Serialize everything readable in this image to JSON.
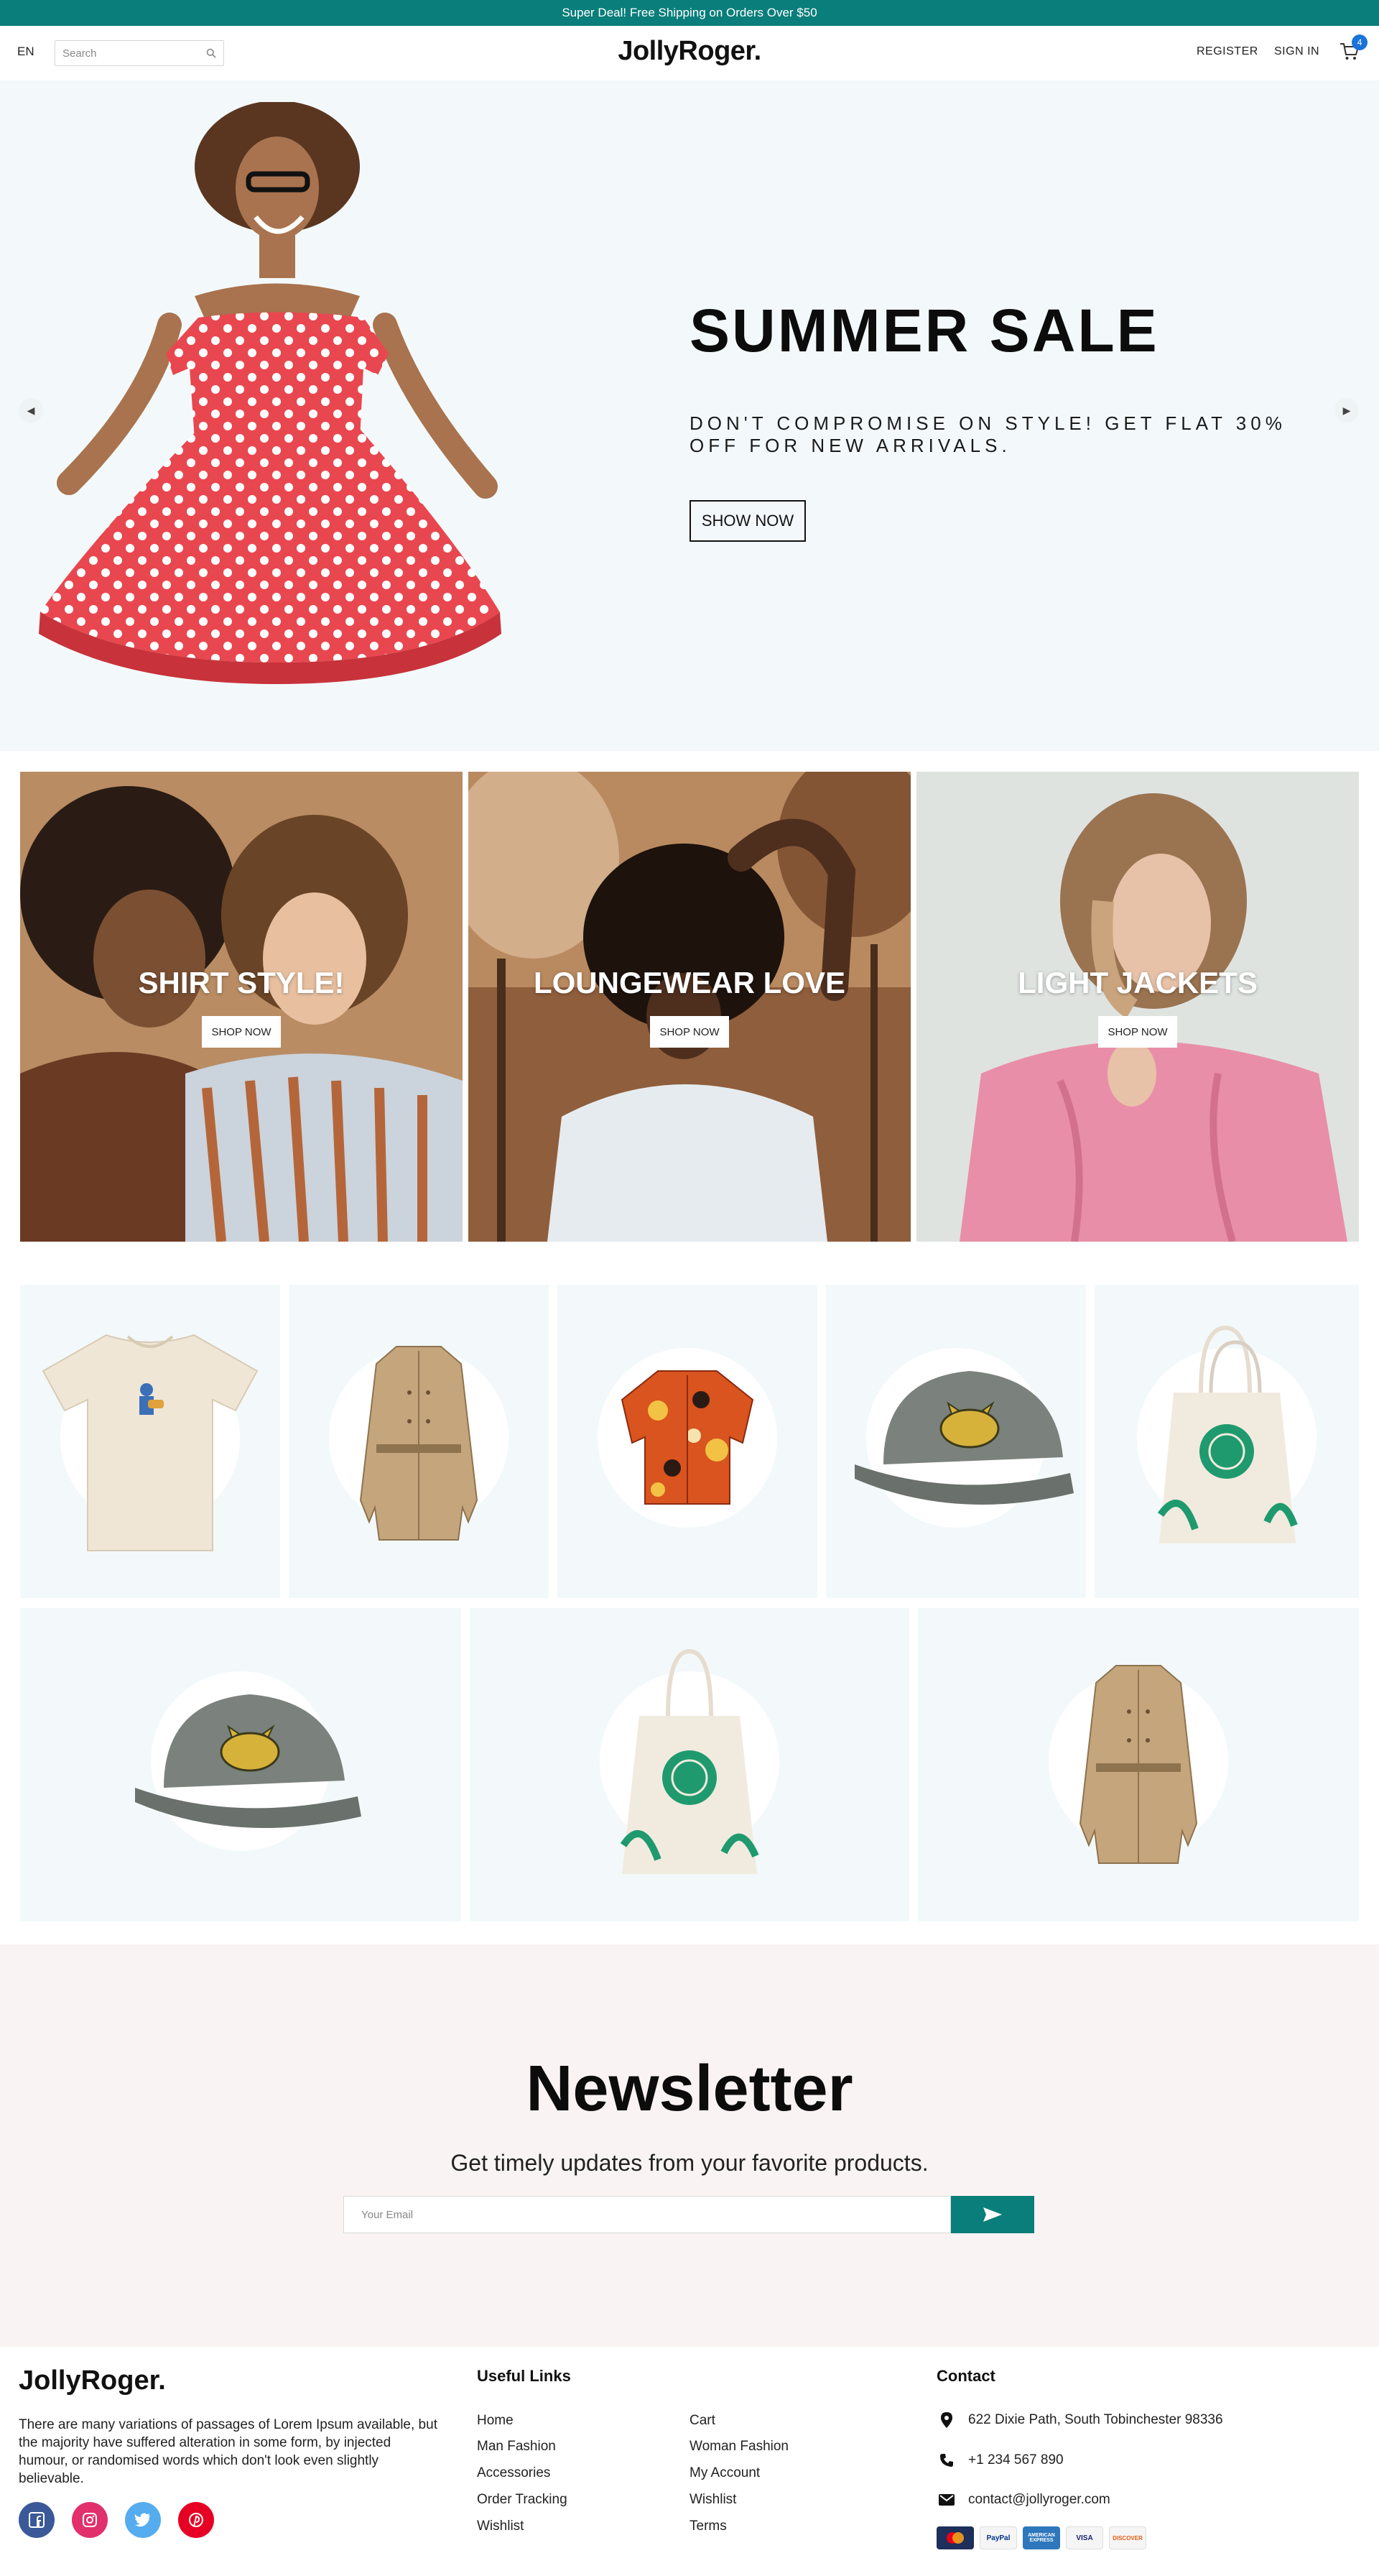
{
  "announcement": "Super Deal! Free Shipping on Orders Over $50",
  "header": {
    "language": "EN",
    "search_placeholder": "Search",
    "logo": "JollyRoger.",
    "register": "REGISTER",
    "sign_in": "SIGN IN",
    "cart_count": "4"
  },
  "hero": {
    "title": "SUMMER SALE",
    "subtitle": "DON'T COMPROMISE ON STYLE! GET FLAT 30% OFF FOR NEW ARRIVALS.",
    "button": "SHOW NOW",
    "prev_icon": "chevron-left-icon",
    "next_icon": "chevron-right-icon"
  },
  "categories": [
    {
      "title": "SHIRT STYLE!",
      "button": "SHOP NOW"
    },
    {
      "title": "LOUNGEWEAR LOVE",
      "button": "SHOP NOW"
    },
    {
      "title": "LIGHT JACKETS",
      "button": "SHOP NOW"
    }
  ],
  "products": [
    {
      "item": "t-shirt"
    },
    {
      "item": "trench-coat"
    },
    {
      "item": "hawaiian-shirt"
    },
    {
      "item": "cap"
    },
    {
      "item": "tote-bag"
    },
    {
      "item": "cap"
    },
    {
      "item": "tote-bag"
    },
    {
      "item": "trench-coat"
    }
  ],
  "newsletter": {
    "title": "Newsletter",
    "subtitle": "Get timely updates from your favorite products.",
    "email_placeholder": "Your Email",
    "send_icon": "send-icon"
  },
  "footer": {
    "logo": "JollyRoger.",
    "description": "There are many variations of passages of Lorem Ipsum available, but the majority have suffered alteration in some form, by injected humour, or randomised words which don't look even slightly believable.",
    "social": [
      "facebook-icon",
      "instagram-icon",
      "twitter-icon",
      "pinterest-icon"
    ],
    "useful_links_title": "Useful Links",
    "links_col1": [
      "Home",
      "Man Fashion",
      "Accessories",
      "Order Tracking",
      "Wishlist"
    ],
    "links_col2": [
      "Cart",
      "Woman Fashion",
      "My Account",
      "Wishlist",
      "Terms"
    ],
    "contact_title": "Contact",
    "address": "622 Dixie Path, South Tobinchester 98336",
    "phone": "+1 234 567 890",
    "email": "contact@jollyroger.com",
    "payment_methods": [
      "MasterCard",
      "PayPal",
      "AMERICAN EXPRESS",
      "VISA",
      "DISCOVER"
    ]
  },
  "colors": {
    "brand_teal": "#0a7e7a",
    "hero_bg": "#f3f9fa",
    "newsletter_bg": "#faf3f3",
    "badge_blue": "#1a73d9"
  }
}
